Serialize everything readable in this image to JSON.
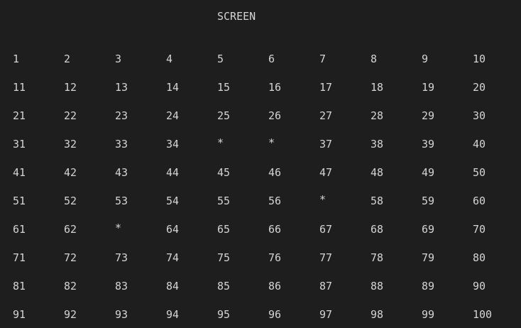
{
  "screen": {
    "title": "SCREEN"
  },
  "grid": {
    "rows": [
      [
        "1",
        "2",
        "3",
        "4",
        "5",
        "6",
        "7",
        "8",
        "9",
        "10"
      ],
      [
        "11",
        "12",
        "13",
        "14",
        "15",
        "16",
        "17",
        "18",
        "19",
        "20"
      ],
      [
        "21",
        "22",
        "23",
        "24",
        "25",
        "26",
        "27",
        "28",
        "29",
        "30"
      ],
      [
        "31",
        "32",
        "33",
        "34",
        "*",
        "*",
        "37",
        "38",
        "39",
        "40"
      ],
      [
        "41",
        "42",
        "43",
        "44",
        "45",
        "46",
        "47",
        "48",
        "49",
        "50"
      ],
      [
        "51",
        "52",
        "53",
        "54",
        "55",
        "56",
        "*",
        "58",
        "59",
        "60"
      ],
      [
        "61",
        "62",
        "*",
        "64",
        "65",
        "66",
        "67",
        "68",
        "69",
        "70"
      ],
      [
        "71",
        "72",
        "73",
        "74",
        "75",
        "76",
        "77",
        "78",
        "79",
        "80"
      ],
      [
        "81",
        "82",
        "83",
        "84",
        "85",
        "86",
        "87",
        "88",
        "89",
        "90"
      ],
      [
        "91",
        "92",
        "93",
        "94",
        "95",
        "96",
        "97",
        "98",
        "99",
        "100"
      ]
    ]
  },
  "colors": {
    "background": "#1e1e1e",
    "text": "#d4d4d4"
  }
}
